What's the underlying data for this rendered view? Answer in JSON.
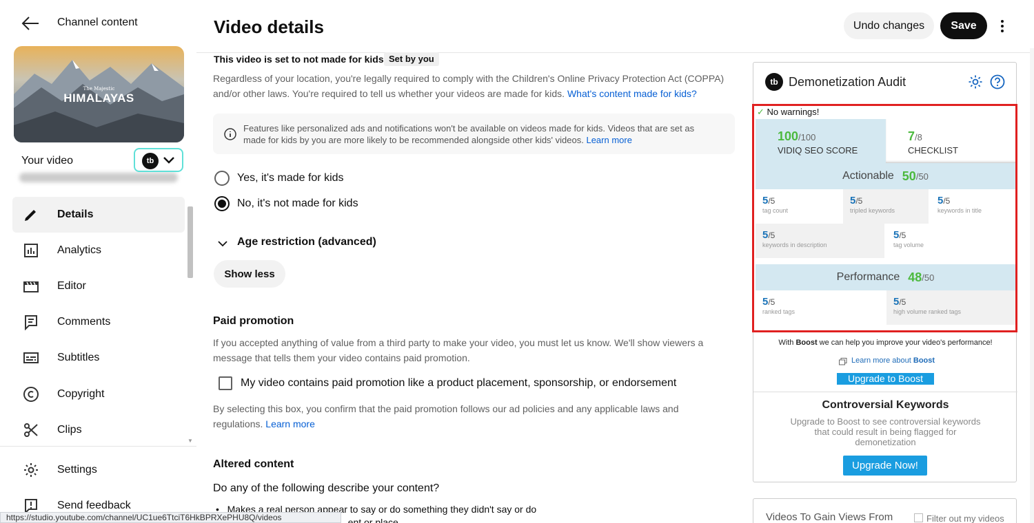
{
  "sidebar": {
    "back_icon": "arrow-left-icon",
    "title": "Channel content",
    "thumbnail": {
      "small_title": "The Majestic",
      "big_title": "HIMALAYAS"
    },
    "your_video_label": "Your video",
    "extension_logo": "tb",
    "nav": [
      {
        "label": "Details",
        "icon": "pencil-icon",
        "active": true
      },
      {
        "label": "Analytics",
        "icon": "analytics-icon"
      },
      {
        "label": "Editor",
        "icon": "clapperboard-icon"
      },
      {
        "label": "Comments",
        "icon": "comment-icon"
      },
      {
        "label": "Subtitles",
        "icon": "subtitles-icon"
      },
      {
        "label": "Copyright",
        "icon": "copyright-icon"
      },
      {
        "label": "Clips",
        "icon": "scissors-icon"
      }
    ],
    "footer": [
      {
        "label": "Settings",
        "icon": "gear-icon"
      },
      {
        "label": "Send feedback",
        "icon": "feedback-icon"
      }
    ]
  },
  "status_url": "https://studio.youtube.com/channel/UC1ue6TtciT6HkBPRXePHU8Q/videos",
  "header": {
    "title": "Video details",
    "undo_label": "Undo changes",
    "save_label": "Save"
  },
  "kids": {
    "heading": "This video is set to not made for kids",
    "badge": "Set by you",
    "desc": "Regardless of your location, you're legally required to comply with the Children's Online Privacy Protection Act (COPPA) and/or other laws. You're required to tell us whether your videos are made for kids.",
    "desc_link": "What's content made for kids?",
    "info": "Features like personalized ads and notifications won't be available on videos made for kids. Videos that are set as made for kids by you are more likely to be recommended alongside other kids' videos.",
    "info_link": "Learn more",
    "options": [
      "Yes, it's made for kids",
      "No, it's not made for kids"
    ],
    "selected": 1
  },
  "age_restriction": {
    "label": "Age restriction (advanced)",
    "show_less": "Show less"
  },
  "paid": {
    "title": "Paid promotion",
    "desc": "If you accepted anything of value from a third party to make your video, you must let us know. We'll show viewers a message that tells them your video contains paid promotion.",
    "checkbox_label": "My video contains paid promotion like a product placement, sponsorship, or endorsement",
    "checked": false,
    "note": "By selecting this box, you confirm that the paid promotion follows our ad policies and any applicable laws and regulations.",
    "note_link": "Learn more"
  },
  "altered": {
    "title": "Altered content",
    "question": "Do any of the following describe your content?",
    "bullets": [
      "Makes a real person appear to say or do something they didn't say or do",
      "...ent or place"
    ]
  },
  "panel": {
    "title": "Demonetization Audit",
    "no_warnings": "No warnings!",
    "seo_score": {
      "value": "100",
      "max": "/100",
      "label": "VIDIQ SEO SCORE"
    },
    "checklist": {
      "value": "7",
      "max": "/8",
      "label": "CHECKLIST"
    },
    "actionable": {
      "label": "Actionable",
      "value": "50",
      "max": "/50"
    },
    "actionable_cells": [
      {
        "value": "5",
        "max": "/5",
        "label": "tag count"
      },
      {
        "value": "5",
        "max": "/5",
        "label": "tripled keywords"
      },
      {
        "value": "5",
        "max": "/5",
        "label": "keywords in title"
      },
      {
        "value": "5",
        "max": "/5",
        "label": "keywords in description"
      },
      {
        "value": "5",
        "max": "/5",
        "label": "tag volume"
      }
    ],
    "performance": {
      "label": "Performance",
      "value": "48",
      "max": "/50"
    },
    "performance_cells": [
      {
        "value": "5",
        "max": "/5",
        "label": "ranked tags"
      },
      {
        "value": "5",
        "max": "/5",
        "label": "high volume ranked tags"
      }
    ],
    "boost_pre": "With ",
    "boost_word": "Boost",
    "boost_post": " we can help you improve your video's performance!",
    "learn_boost_pre": "Learn more about ",
    "learn_boost_word": "Boost",
    "upgrade_boost": "Upgrade to Boost",
    "contro_title": "Controversial Keywords",
    "contro_desc": "Upgrade to Boost to see controversial keywords that could result in being flagged for demonetization",
    "upgrade_now": "Upgrade Now!"
  },
  "panel2": {
    "title": "Videos To Gain Views From",
    "filter_label": "Filter out my videos"
  }
}
